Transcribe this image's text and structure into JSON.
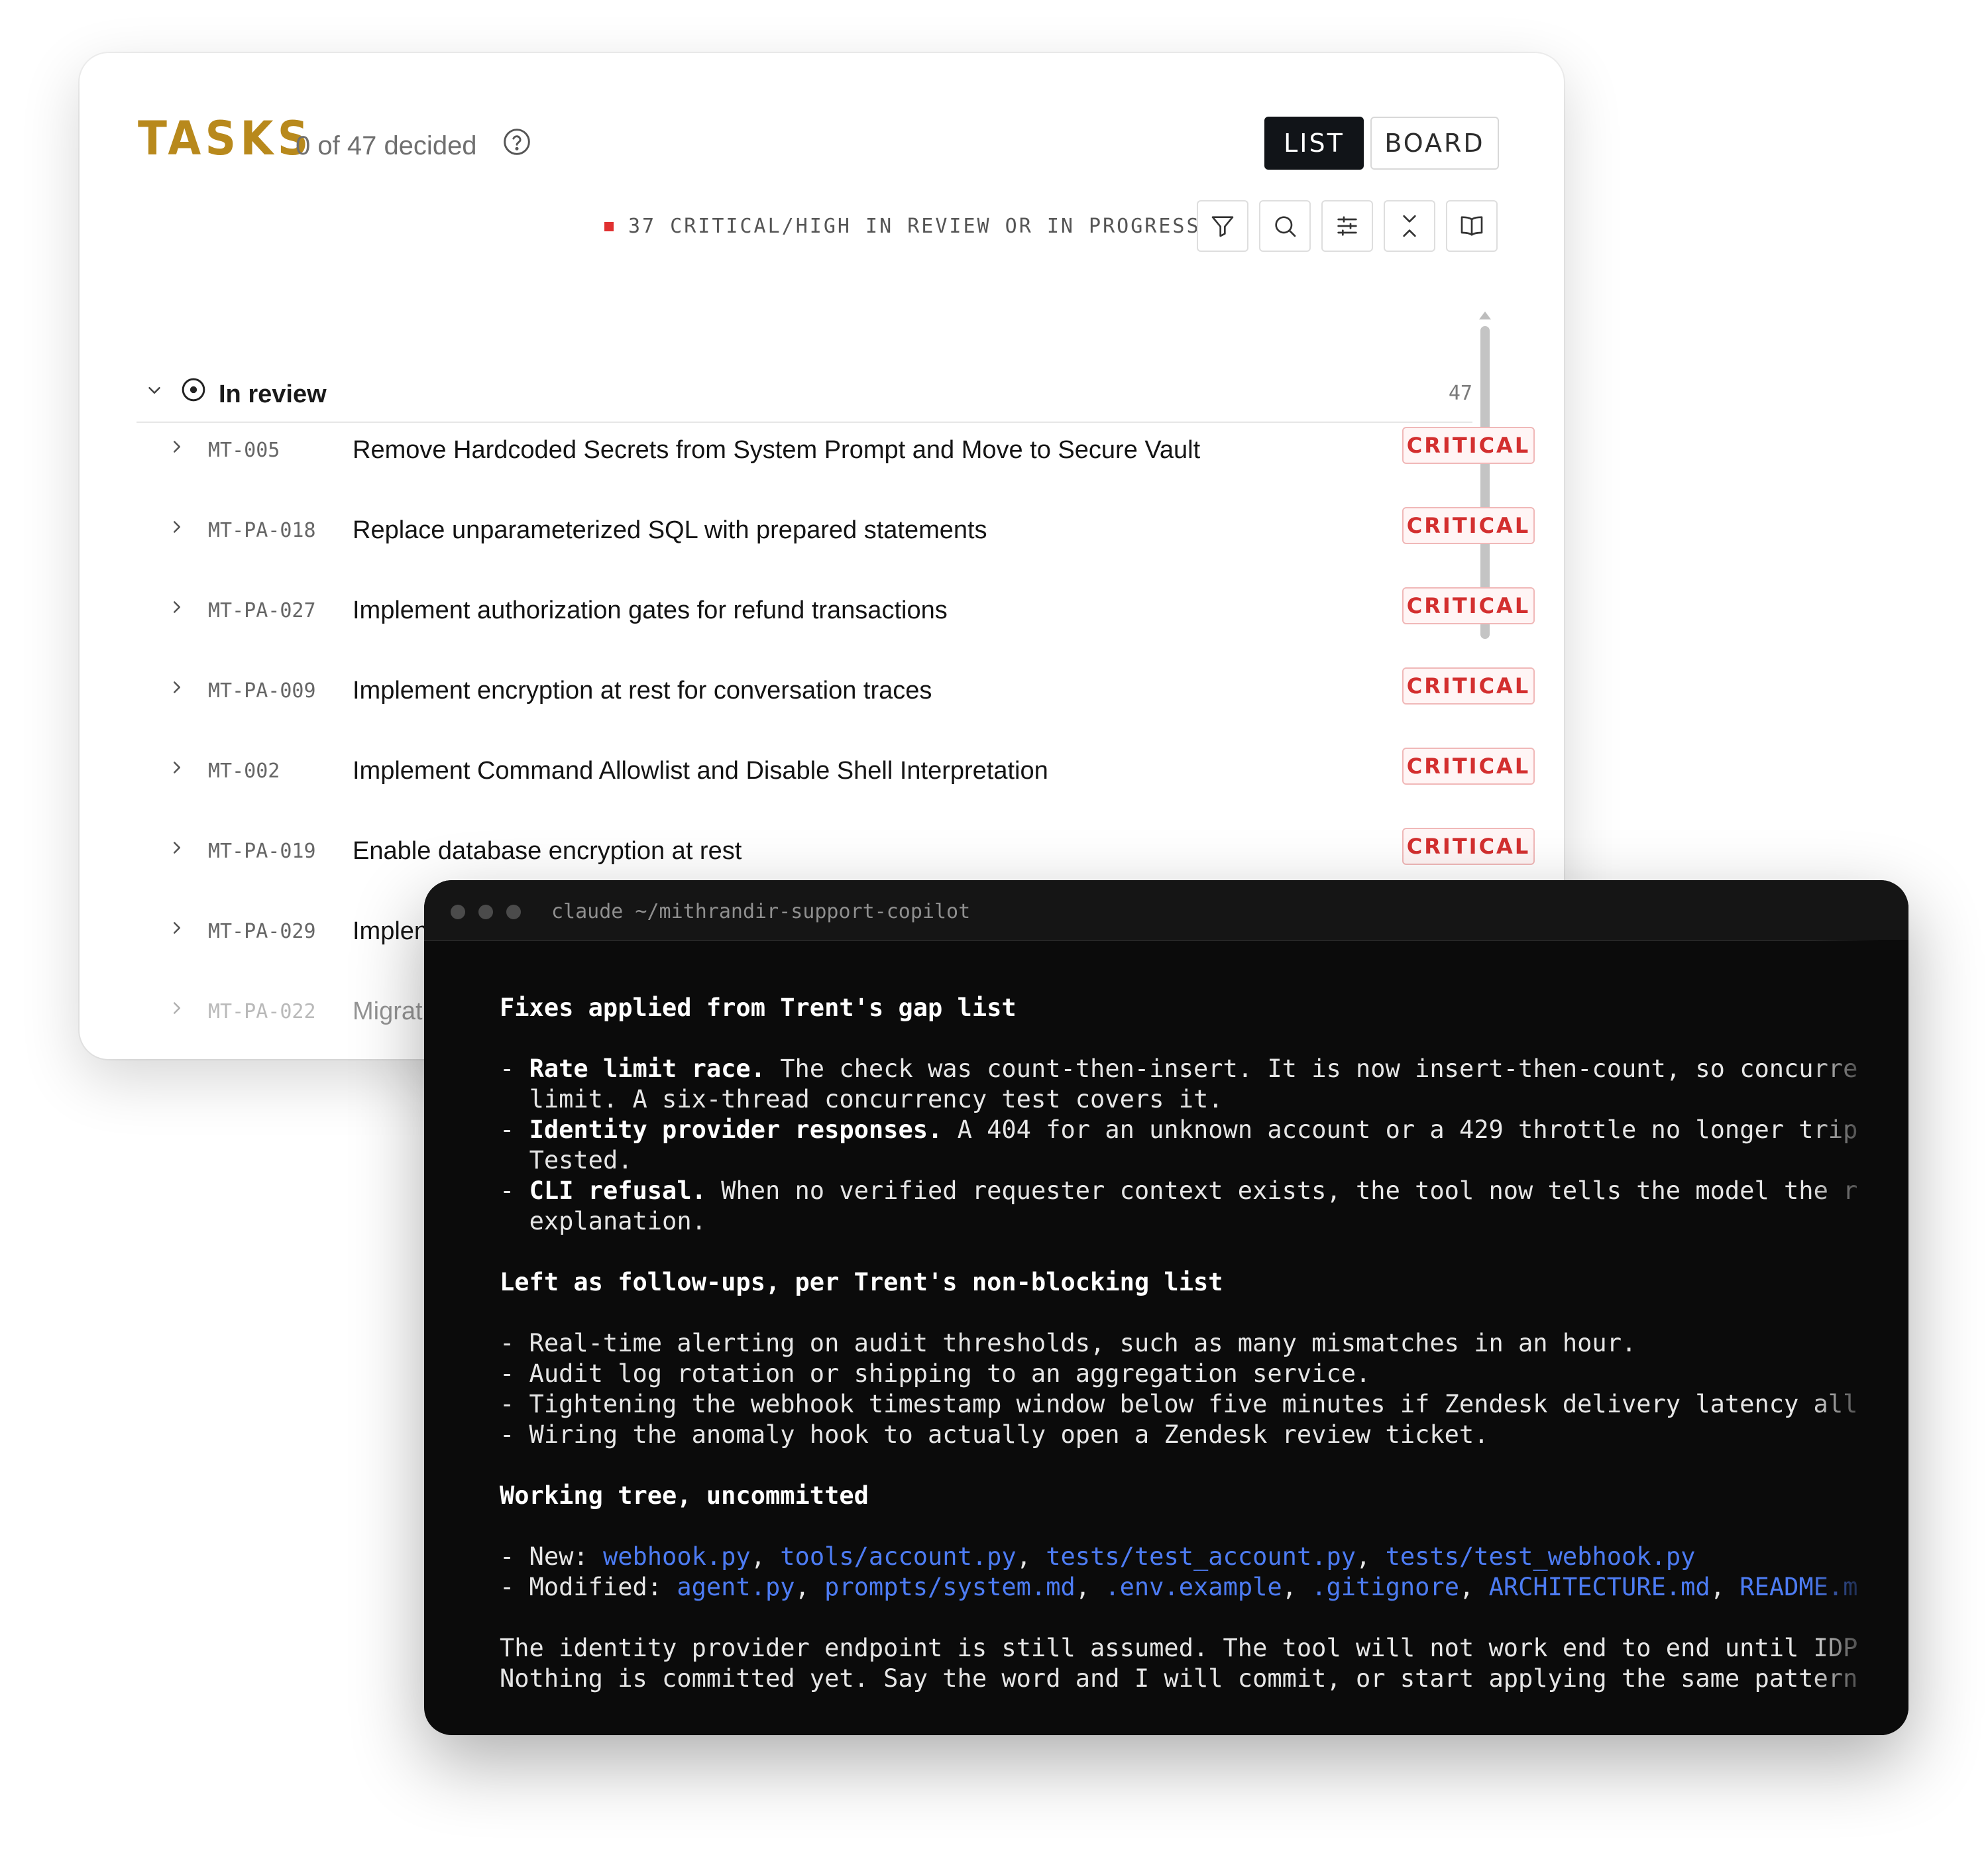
{
  "tasks": {
    "title": "TASKS",
    "decided": "0 of 47 decided",
    "views": {
      "list": "LIST",
      "board": "BOARD",
      "active": "LIST"
    },
    "summary": "37 CRITICAL/HIGH IN REVIEW OR IN PROGRESS",
    "group": {
      "label": "In review",
      "count": "47"
    },
    "rows": [
      {
        "id": "MT-005",
        "title": "Remove Hardcoded Secrets from System Prompt and Move to Secure Vault",
        "severity": "CRITICAL"
      },
      {
        "id": "MT-PA-018",
        "title": "Replace unparameterized SQL with prepared statements",
        "severity": "CRITICAL"
      },
      {
        "id": "MT-PA-027",
        "title": "Implement authorization gates for refund transactions",
        "severity": "CRITICAL"
      },
      {
        "id": "MT-PA-009",
        "title": "Implement encryption at rest for conversation traces",
        "severity": "CRITICAL"
      },
      {
        "id": "MT-002",
        "title": "Implement Command Allowlist and Disable Shell Interpretation",
        "severity": "CRITICAL"
      },
      {
        "id": "MT-PA-019",
        "title": "Enable database encryption at rest",
        "severity": "CRITICAL"
      },
      {
        "id": "MT-PA-029",
        "title": "Implen",
        "severity": ""
      },
      {
        "id": "MT-PA-022",
        "title": "Migrat",
        "severity": ""
      }
    ]
  },
  "terminal": {
    "title": "claude ~/mithrandir-support-copilot",
    "heading_fixes": "Fixes applied from Trent's gap list",
    "fix1_label": "Rate limit race.",
    "fix1_text": " The check was count-then-insert. It is now insert-then-count, so concurre",
    "fix1_cont": "limit. A six-thread concurrency test covers it.",
    "fix2_label": "Identity provider responses.",
    "fix2_text": " A 404 for an unknown account or a 429 throttle no longer trip",
    "fix2_cont": "Tested.",
    "fix3_label": "CLI refusal.",
    "fix3_text": " When no verified requester context exists, the tool now tells the model the r",
    "fix3_cont": "explanation.",
    "heading_followups": "Left as follow-ups, per Trent's non-blocking list",
    "followups": [
      "- Real-time alerting on audit thresholds, such as many mismatches in an hour.",
      "- Audit log rotation or shipping to an aggregation service.",
      "- Tightening the webhook timestamp window below five minutes if Zendesk delivery latency all",
      "- Wiring the anomaly hook to actually open a Zendesk review ticket."
    ],
    "heading_tree": "Working tree, uncommitted",
    "new_label": "- New: ",
    "new_files": [
      "webhook.py",
      "tools/account.py",
      "tests/test_account.py",
      "tests/test_webhook.py"
    ],
    "modified_label": "- Modified: ",
    "modified_files": [
      "agent.py",
      "prompts/system.md",
      ".env.example",
      ".gitignore",
      "ARCHITECTURE.md",
      "README.m"
    ],
    "footer1": "The identity provider endpoint is still assumed. The tool will not work end to end until IDP",
    "footer2": "Nothing is committed yet. Say the word and I will commit, or start applying the same pattern"
  },
  "colors": {
    "accent_gold": "#b8891c",
    "critical_red": "#d32f2f",
    "terminal_bg": "#0b0b0b",
    "file_link_blue": "#4d7cf3"
  },
  "icons": [
    "help-icon",
    "filter-icon",
    "search-icon",
    "sliders-icon",
    "collapse-icon",
    "book-icon",
    "chevron-down-icon",
    "chevron-right-icon",
    "status-circle-icon"
  ]
}
